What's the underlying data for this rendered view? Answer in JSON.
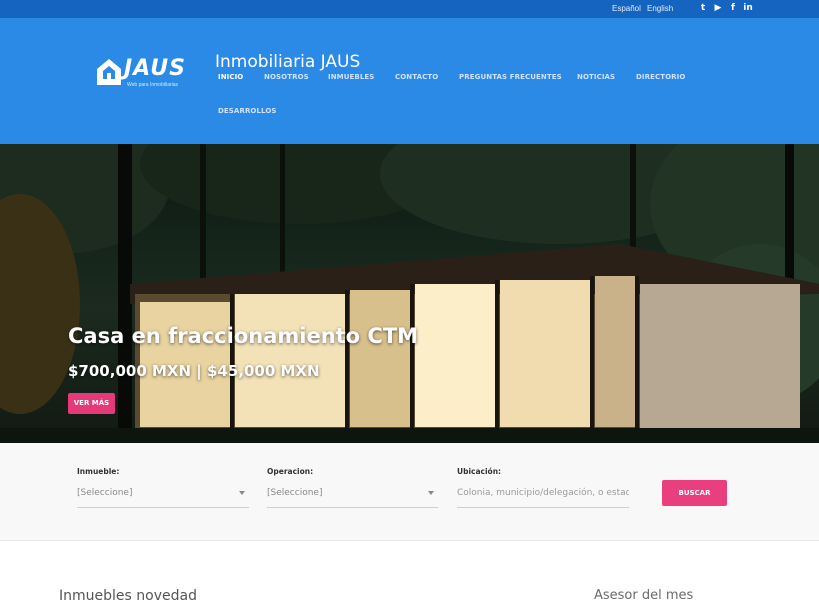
{
  "topbar": {
    "languages": [
      "Español",
      "English"
    ],
    "social_icons": [
      "twitter-icon",
      "youtube-icon",
      "facebook-icon",
      "linkedin-icon"
    ],
    "social_glyphs": [
      "t",
      "▶",
      "f",
      "in"
    ]
  },
  "header": {
    "logo_text": "JAUS",
    "logo_subtext": "Web para Inmobiliarias",
    "site_title": "Inmobiliaria JAUS",
    "nav": [
      "INICIO",
      "NOSOTROS",
      "INMUEBLES",
      "CONTACTO",
      "PREGUNTAS FRECUENTES",
      "NOTICIAS",
      "DIRECTORIO",
      "DESARROLLOS"
    ],
    "active_nav": "INICIO"
  },
  "hero": {
    "title": "Casa en fraccionamiento CTM",
    "price": "$700,000 MXN | $45,000 MXN",
    "button": "VER MÁS"
  },
  "search": {
    "inmueble_label": "Inmueble:",
    "inmueble_value": "[Seleccione]",
    "operacion_label": "Operacion:",
    "operacion_value": "[Seleccione]",
    "ubicacion_label": "Ubicación:",
    "ubicacion_placeholder": "Colonia, municipio/delegación, o estado",
    "button": "BUSCAR"
  },
  "sections": {
    "novedades_title": "Inmuebles novedad",
    "asesor_title": "Asesor del mes"
  },
  "colors": {
    "topbar": "#1565c0",
    "header": "#2a8ae6",
    "accent": "#ea3f7f"
  }
}
